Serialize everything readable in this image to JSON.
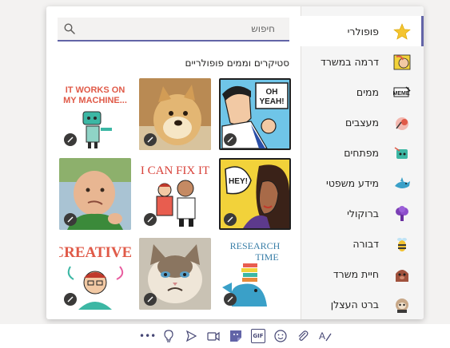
{
  "search": {
    "placeholder": "חיפוש"
  },
  "section_title": "סטיקרים וממים פופולריים",
  "stickers": [
    {
      "name": "it-works-on-my-machine",
      "text": "IT WORKS ON MY MACHINE..."
    },
    {
      "name": "doge-meme",
      "text": ""
    },
    {
      "name": "oh-yeah",
      "text": "OH YEAH!"
    },
    {
      "name": "success-kid-meme",
      "text": ""
    },
    {
      "name": "i-can-fix-it",
      "text": "I CAN FIX IT"
    },
    {
      "name": "hey",
      "text": "HEY!"
    },
    {
      "name": "creative",
      "text": "CREATIVE!"
    },
    {
      "name": "grumpy-cat-meme",
      "text": ""
    },
    {
      "name": "research-time",
      "text": "RESEARCH TIME"
    }
  ],
  "categories": [
    {
      "label": "פופולרי",
      "icon": "star-icon"
    },
    {
      "label": "דרמה במשרד",
      "icon": "office-drama-icon"
    },
    {
      "label": "ממים",
      "icon": "meme-icon"
    },
    {
      "label": "מעצבים",
      "icon": "designer-icon"
    },
    {
      "label": "מפתחים",
      "icon": "developer-icon"
    },
    {
      "label": "מידע משפטי",
      "icon": "legal-shark-icon"
    },
    {
      "label": "ברוקולי",
      "icon": "broccoli-icon"
    },
    {
      "label": "דבורה",
      "icon": "bee-icon"
    },
    {
      "label": "חיית משרד",
      "icon": "office-pet-icon"
    },
    {
      "label": "ברט העצלן",
      "icon": "sloth-icon"
    }
  ],
  "toolbar": [
    "more-options-icon",
    "praise-icon",
    "deliver-icon",
    "meet-now-icon",
    "sticker-icon",
    "gif-icon",
    "emoji-icon",
    "attach-icon",
    "format-icon"
  ],
  "toolbar_labels": {
    "more": "•••",
    "gif": "GIF"
  },
  "colors": {
    "accent": "#6264a7",
    "search_bg": "#f3f2f1",
    "sidebar_bg": "#f5f5f5"
  }
}
